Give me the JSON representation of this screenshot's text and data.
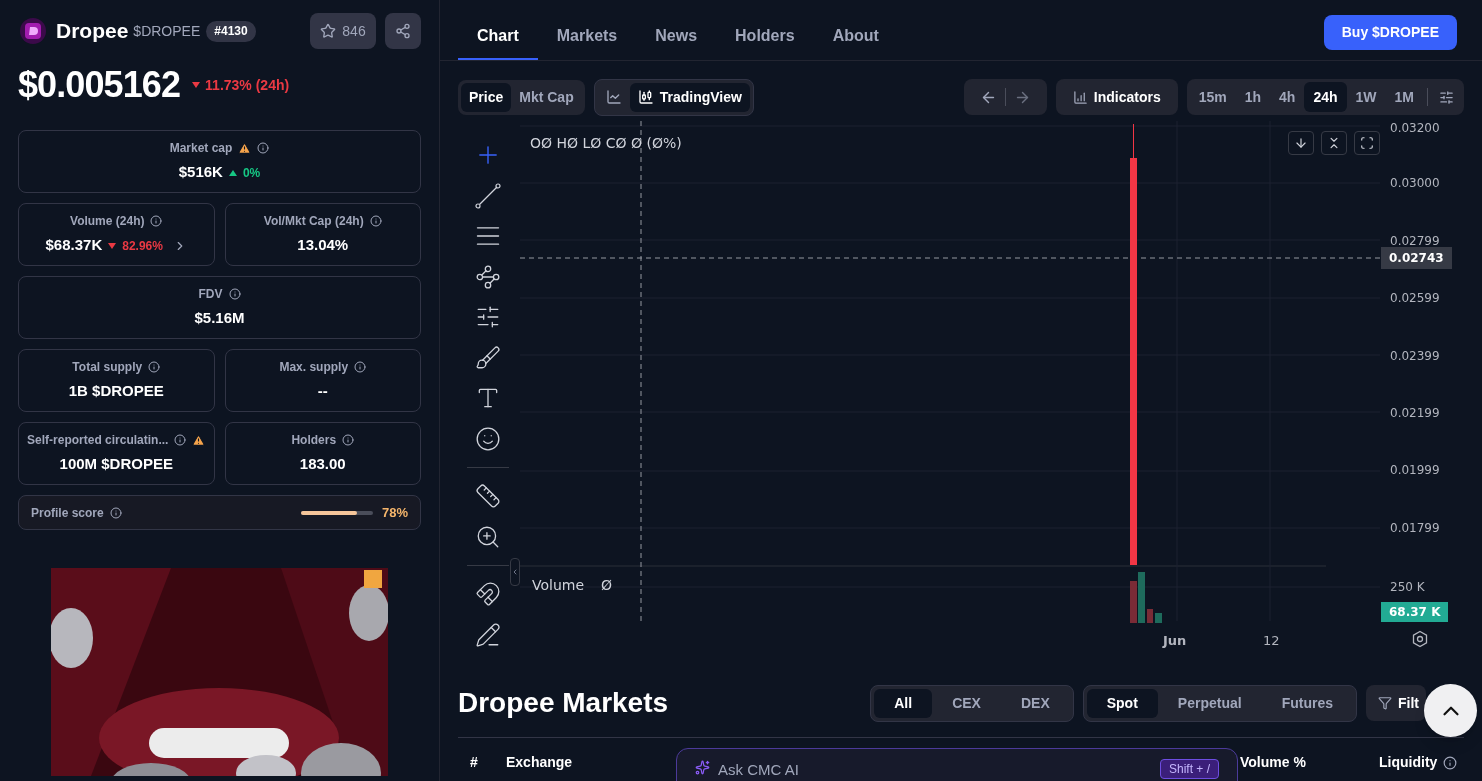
{
  "coin": {
    "name": "Dropee",
    "symbol": "$DROPEE",
    "rank": "#4130",
    "watchlist_count": "846"
  },
  "price": {
    "value": "$0.005162",
    "change": "11.73% (24h)",
    "rising": false
  },
  "stat_rows": [
    [
      {
        "label": "Market cap",
        "value": "$516K",
        "change": "0%",
        "rising": true,
        "warning_before_info": true,
        "warning_after_info": false,
        "link": false
      }
    ],
    [
      {
        "label": "Volume (24h)",
        "value": "$68.37K",
        "change": "82.96%",
        "rising": false,
        "warning_before_info": false,
        "warning_after_info": false,
        "link": true
      },
      {
        "label": "Vol/Mkt Cap (24h)",
        "value": "13.04%",
        "warning_before_info": false,
        "warning_after_info": false,
        "link": false
      }
    ],
    [
      {
        "label": "FDV",
        "value": "$5.16M",
        "warning_before_info": false,
        "warning_after_info": false,
        "link": false
      }
    ],
    [
      {
        "label": "Total supply",
        "value": "1B $DROPEE",
        "warning_before_info": false,
        "warning_after_info": false,
        "link": false
      },
      {
        "label": "Max. supply",
        "value": "--",
        "warning_before_info": false,
        "warning_after_info": false,
        "link": false
      }
    ],
    [
      {
        "label": "Self-reported circulatin...",
        "value": "100M $DROPEE",
        "warning_before_info": false,
        "warning_after_info": true,
        "link": false
      },
      {
        "label": "Holders",
        "value": "183.00",
        "warning_before_info": false,
        "warning_after_info": false,
        "link": false
      }
    ]
  ],
  "profile_score": {
    "label": "Profile score",
    "level": 0.78,
    "reading": "78%"
  },
  "tabs": [
    {
      "label": "Chart",
      "selected": true
    },
    {
      "label": "Markets",
      "selected": false
    },
    {
      "label": "News",
      "selected": false
    },
    {
      "label": "Holders",
      "selected": false
    },
    {
      "label": "About",
      "selected": false
    }
  ],
  "buy_button": "Buy $DROPEE",
  "chart_toolbar": {
    "value_modes": [
      {
        "label": "Price",
        "selected": true
      },
      {
        "label": "Mkt Cap",
        "selected": false
      }
    ],
    "chart_types": [
      {
        "kind": "line",
        "selected": false
      },
      {
        "kind": "candles",
        "label": "TradingView",
        "selected": true
      }
    ],
    "indicators": "Indicators",
    "timeframes": [
      {
        "label": "15m",
        "selected": false
      },
      {
        "label": "1h",
        "selected": false
      },
      {
        "label": "4h",
        "selected": false
      },
      {
        "label": "24h",
        "selected": true
      },
      {
        "label": "1W",
        "selected": false
      },
      {
        "label": "1M",
        "selected": false
      }
    ]
  },
  "chart": {
    "legend": "OØ HØ LØ CØ Ø (Ø%)",
    "price_axis": [
      "0.03200",
      "0.03000",
      "0.02799",
      "0.02599",
      "0.02399",
      "0.02199",
      "0.01999",
      "0.01799"
    ],
    "crosshair_price": "0.02743",
    "volume_legend": "Volume",
    "volume_value": "Ø",
    "volume_axis": "250 K",
    "last_volume": "68.37 K",
    "time_axis": [
      "Jun",
      "12"
    ]
  },
  "markets": {
    "title": "Dropee Markets",
    "venue_filters": [
      {
        "label": "All",
        "selected": true
      },
      {
        "label": "CEX",
        "selected": false
      },
      {
        "label": "DEX",
        "selected": false
      }
    ],
    "contract_filters": [
      {
        "label": "Spot",
        "selected": true
      },
      {
        "label": "Perpetual",
        "selected": false
      },
      {
        "label": "Futures",
        "selected": false
      }
    ],
    "filter_button": "Filt",
    "columns": [
      "#",
      "Exchange",
      "Volume %",
      "Liquidity"
    ]
  },
  "ask_ai": {
    "placeholder": "Ask CMC AI",
    "shortcut": "Shift + /"
  }
}
